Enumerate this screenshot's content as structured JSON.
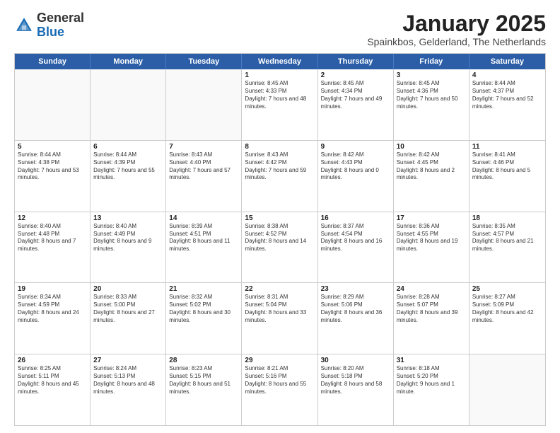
{
  "header": {
    "logo_general": "General",
    "logo_blue": "Blue",
    "month_year": "January 2025",
    "location": "Spainkbos, Gelderland, The Netherlands"
  },
  "days_of_week": [
    "Sunday",
    "Monday",
    "Tuesday",
    "Wednesday",
    "Thursday",
    "Friday",
    "Saturday"
  ],
  "weeks": [
    [
      {
        "day": "",
        "empty": true
      },
      {
        "day": "",
        "empty": true
      },
      {
        "day": "",
        "empty": true
      },
      {
        "day": "1",
        "sunrise": "Sunrise: 8:45 AM",
        "sunset": "Sunset: 4:33 PM",
        "daylight": "Daylight: 7 hours and 48 minutes."
      },
      {
        "day": "2",
        "sunrise": "Sunrise: 8:45 AM",
        "sunset": "Sunset: 4:34 PM",
        "daylight": "Daylight: 7 hours and 49 minutes."
      },
      {
        "day": "3",
        "sunrise": "Sunrise: 8:45 AM",
        "sunset": "Sunset: 4:36 PM",
        "daylight": "Daylight: 7 hours and 50 minutes."
      },
      {
        "day": "4",
        "sunrise": "Sunrise: 8:44 AM",
        "sunset": "Sunset: 4:37 PM",
        "daylight": "Daylight: 7 hours and 52 minutes."
      }
    ],
    [
      {
        "day": "5",
        "sunrise": "Sunrise: 8:44 AM",
        "sunset": "Sunset: 4:38 PM",
        "daylight": "Daylight: 7 hours and 53 minutes."
      },
      {
        "day": "6",
        "sunrise": "Sunrise: 8:44 AM",
        "sunset": "Sunset: 4:39 PM",
        "daylight": "Daylight: 7 hours and 55 minutes."
      },
      {
        "day": "7",
        "sunrise": "Sunrise: 8:43 AM",
        "sunset": "Sunset: 4:40 PM",
        "daylight": "Daylight: 7 hours and 57 minutes."
      },
      {
        "day": "8",
        "sunrise": "Sunrise: 8:43 AM",
        "sunset": "Sunset: 4:42 PM",
        "daylight": "Daylight: 7 hours and 59 minutes."
      },
      {
        "day": "9",
        "sunrise": "Sunrise: 8:42 AM",
        "sunset": "Sunset: 4:43 PM",
        "daylight": "Daylight: 8 hours and 0 minutes."
      },
      {
        "day": "10",
        "sunrise": "Sunrise: 8:42 AM",
        "sunset": "Sunset: 4:45 PM",
        "daylight": "Daylight: 8 hours and 2 minutes."
      },
      {
        "day": "11",
        "sunrise": "Sunrise: 8:41 AM",
        "sunset": "Sunset: 4:46 PM",
        "daylight": "Daylight: 8 hours and 5 minutes."
      }
    ],
    [
      {
        "day": "12",
        "sunrise": "Sunrise: 8:40 AM",
        "sunset": "Sunset: 4:48 PM",
        "daylight": "Daylight: 8 hours and 7 minutes."
      },
      {
        "day": "13",
        "sunrise": "Sunrise: 8:40 AM",
        "sunset": "Sunset: 4:49 PM",
        "daylight": "Daylight: 8 hours and 9 minutes."
      },
      {
        "day": "14",
        "sunrise": "Sunrise: 8:39 AM",
        "sunset": "Sunset: 4:51 PM",
        "daylight": "Daylight: 8 hours and 11 minutes."
      },
      {
        "day": "15",
        "sunrise": "Sunrise: 8:38 AM",
        "sunset": "Sunset: 4:52 PM",
        "daylight": "Daylight: 8 hours and 14 minutes."
      },
      {
        "day": "16",
        "sunrise": "Sunrise: 8:37 AM",
        "sunset": "Sunset: 4:54 PM",
        "daylight": "Daylight: 8 hours and 16 minutes."
      },
      {
        "day": "17",
        "sunrise": "Sunrise: 8:36 AM",
        "sunset": "Sunset: 4:55 PM",
        "daylight": "Daylight: 8 hours and 19 minutes."
      },
      {
        "day": "18",
        "sunrise": "Sunrise: 8:35 AM",
        "sunset": "Sunset: 4:57 PM",
        "daylight": "Daylight: 8 hours and 21 minutes."
      }
    ],
    [
      {
        "day": "19",
        "sunrise": "Sunrise: 8:34 AM",
        "sunset": "Sunset: 4:59 PM",
        "daylight": "Daylight: 8 hours and 24 minutes."
      },
      {
        "day": "20",
        "sunrise": "Sunrise: 8:33 AM",
        "sunset": "Sunset: 5:00 PM",
        "daylight": "Daylight: 8 hours and 27 minutes."
      },
      {
        "day": "21",
        "sunrise": "Sunrise: 8:32 AM",
        "sunset": "Sunset: 5:02 PM",
        "daylight": "Daylight: 8 hours and 30 minutes."
      },
      {
        "day": "22",
        "sunrise": "Sunrise: 8:31 AM",
        "sunset": "Sunset: 5:04 PM",
        "daylight": "Daylight: 8 hours and 33 minutes."
      },
      {
        "day": "23",
        "sunrise": "Sunrise: 8:29 AM",
        "sunset": "Sunset: 5:06 PM",
        "daylight": "Daylight: 8 hours and 36 minutes."
      },
      {
        "day": "24",
        "sunrise": "Sunrise: 8:28 AM",
        "sunset": "Sunset: 5:07 PM",
        "daylight": "Daylight: 8 hours and 39 minutes."
      },
      {
        "day": "25",
        "sunrise": "Sunrise: 8:27 AM",
        "sunset": "Sunset: 5:09 PM",
        "daylight": "Daylight: 8 hours and 42 minutes."
      }
    ],
    [
      {
        "day": "26",
        "sunrise": "Sunrise: 8:25 AM",
        "sunset": "Sunset: 5:11 PM",
        "daylight": "Daylight: 8 hours and 45 minutes."
      },
      {
        "day": "27",
        "sunrise": "Sunrise: 8:24 AM",
        "sunset": "Sunset: 5:13 PM",
        "daylight": "Daylight: 8 hours and 48 minutes."
      },
      {
        "day": "28",
        "sunrise": "Sunrise: 8:23 AM",
        "sunset": "Sunset: 5:15 PM",
        "daylight": "Daylight: 8 hours and 51 minutes."
      },
      {
        "day": "29",
        "sunrise": "Sunrise: 8:21 AM",
        "sunset": "Sunset: 5:16 PM",
        "daylight": "Daylight: 8 hours and 55 minutes."
      },
      {
        "day": "30",
        "sunrise": "Sunrise: 8:20 AM",
        "sunset": "Sunset: 5:18 PM",
        "daylight": "Daylight: 8 hours and 58 minutes."
      },
      {
        "day": "31",
        "sunrise": "Sunrise: 8:18 AM",
        "sunset": "Sunset: 5:20 PM",
        "daylight": "Daylight: 9 hours and 1 minute."
      },
      {
        "day": "",
        "empty": true
      }
    ]
  ]
}
